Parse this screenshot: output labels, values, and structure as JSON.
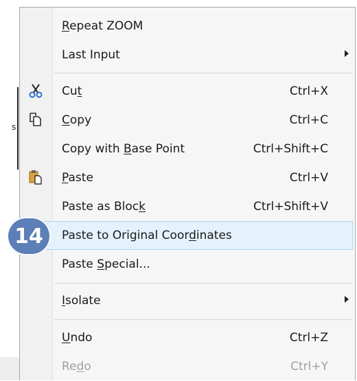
{
  "badge": {
    "number": "14",
    "color": "#5b7fb6"
  },
  "background": {
    "marker": "s"
  },
  "menu": {
    "items": [
      {
        "pre": "",
        "u": "R",
        "post": "epeat ZOOM",
        "shortcut": "",
        "submenu": false
      },
      {
        "pre": "Last Input",
        "u": "",
        "post": "",
        "shortcut": "",
        "submenu": true
      },
      {
        "pre": "Cu",
        "u": "t",
        "post": "",
        "shortcut": "Ctrl+X",
        "icon": "scissors-icon"
      },
      {
        "pre": "",
        "u": "C",
        "post": "opy",
        "shortcut": "Ctrl+C",
        "icon": "copy-icon"
      },
      {
        "pre": "Copy with ",
        "u": "B",
        "post": "ase Point",
        "shortcut": "Ctrl+Shift+C"
      },
      {
        "pre": "",
        "u": "P",
        "post": "aste",
        "shortcut": "Ctrl+V",
        "icon": "paste-icon"
      },
      {
        "pre": "Paste as Bloc",
        "u": "k",
        "post": "",
        "shortcut": "Ctrl+Shift+V"
      },
      {
        "pre": "Paste to Original Coor",
        "u": "d",
        "post": "inates",
        "shortcut": "",
        "highlighted": true
      },
      {
        "pre": "Paste ",
        "u": "S",
        "post": "pecial...",
        "shortcut": ""
      },
      {
        "pre": "",
        "u": "I",
        "post": "solate",
        "shortcut": "",
        "submenu": true
      },
      {
        "pre": "",
        "u": "U",
        "post": "ndo",
        "shortcut": "Ctrl+Z"
      },
      {
        "pre": "Re",
        "u": "d",
        "post": "o",
        "shortcut": "Ctrl+Y",
        "disabled": true
      }
    ]
  }
}
